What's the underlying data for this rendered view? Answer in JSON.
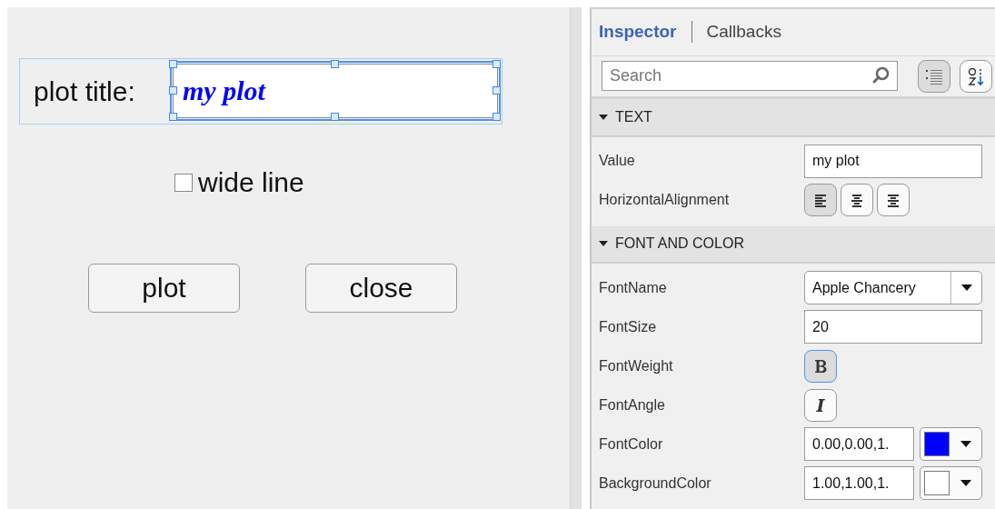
{
  "canvas": {
    "label": "plot title:",
    "title_field": {
      "value": "my plot",
      "selected": true,
      "color": "#0000ff"
    },
    "checkbox": {
      "label": "wide line",
      "checked": false
    },
    "buttons": [
      "plot",
      "close"
    ]
  },
  "inspector": {
    "tabs": [
      {
        "label": "Inspector",
        "selected": true
      },
      {
        "label": "Callbacks",
        "selected": false
      }
    ],
    "search": {
      "placeholder": "Search"
    },
    "view_buttons": [
      {
        "kind": "grouped",
        "selected": true
      },
      {
        "kind": "alphabetical",
        "selected": false
      }
    ],
    "sections": [
      {
        "title": "TEXT",
        "expanded": true,
        "properties": [
          {
            "kind": "text",
            "name": "Value",
            "value": "my plot"
          },
          {
            "kind": "alignment",
            "name": "HorizontalAlignment",
            "options": [
              {
                "kind": "left",
                "selected": true
              },
              {
                "kind": "center",
                "selected": false
              },
              {
                "kind": "right",
                "selected": false
              }
            ]
          }
        ]
      },
      {
        "title": "FONT AND COLOR",
        "expanded": true,
        "properties": [
          {
            "kind": "dropdown",
            "name": "FontName",
            "value": "Apple Chancery"
          },
          {
            "kind": "text",
            "name": "FontSize",
            "value": "20"
          },
          {
            "kind": "bold",
            "name": "FontWeight",
            "selected": true
          },
          {
            "kind": "italic",
            "name": "FontAngle",
            "selected": false
          },
          {
            "kind": "color",
            "name": "FontColor",
            "value": "0.00,0.00,1.",
            "color": "#0000ff"
          },
          {
            "kind": "color",
            "name": "BackgroundColor",
            "value": "1.00,1.00,1.",
            "color": "#ffffff"
          }
        ]
      }
    ]
  }
}
